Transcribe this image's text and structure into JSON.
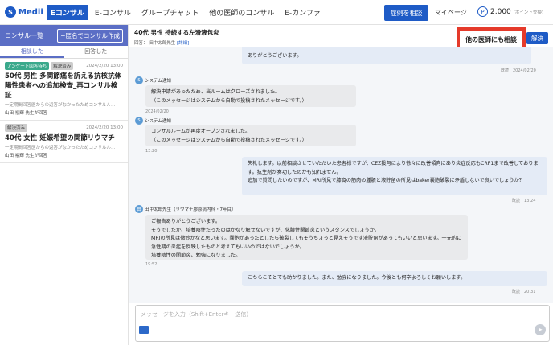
{
  "brand": {
    "name": "Medii",
    "product": "Eコンサル"
  },
  "nav": [
    "E-コンサル",
    "グループチャット",
    "他の医師のコンサル",
    "E-カンファ"
  ],
  "header": {
    "consult_button": "症例を相談",
    "mypage": "マイページ",
    "points": "2,000",
    "points_note": "(ポイント交換)"
  },
  "sidebar": {
    "title": "コンサル一覧",
    "new_button": "+匿名でコンサル作成",
    "tabs": [
      "相談した",
      "回答した"
    ],
    "cases": [
      {
        "badges": [
          "アンケート回答待ち",
          "解決済み"
        ],
        "time": "2024/2/20 13:00",
        "title": "50代 男性 多関節痛を訴える抗核抗体陽性患者への追加検査_再コンサル検証",
        "snippet": "一定期間回答医からの返答がなかったためコンサルル…",
        "doctor": "山田 裕輝 先生が回答"
      },
      {
        "badges": [
          "解決済み"
        ],
        "time": "2024/2/20 13:00",
        "title": "40代 女性 妊娠希望の関節リウマチ",
        "snippet": "一定期間回答医からの返答がなかったためコンサルル…",
        "doctor": "山田 裕輝 先生が回答"
      }
    ]
  },
  "chat": {
    "title": "40代 男性 持続する左滑液包炎",
    "responder_label": "回答：",
    "responder": "田中太郎先生",
    "detail_link": "[詳細]",
    "other_doctors_button": "他の医師にも相談",
    "resolve_button": "解決",
    "messages": [
      {
        "kind": "self",
        "text": "ありがとうございます。",
        "time": "既読　2024/02/20"
      },
      {
        "kind": "system",
        "sender": "システム通知",
        "text": "解決申請があったため、当ルームはクローズされました。\n（このメッセージはシステムから自動で投稿されたメッセージです。）",
        "time": "2024/02/20"
      },
      {
        "kind": "system",
        "sender": "システム通知",
        "text": "コンサルルームが再度オープンされました。\n（このメッセージはシステムから自動で投稿されたメッセージです。）",
        "time": "13:20"
      },
      {
        "kind": "self",
        "text": "失礼します。以前相談させていただいた患者様ですが、CEZ投与により徐々に改善傾向にあり炎症反応もCRP1まで改善しております。抗生剤が奏功したのかも知れません。\n追加で質問したいのですが、MRI所見で膝窩の筋肉の腫脹と液貯留の所見はbaker嚢胞破裂に矛盾しないで良いでしょうか？",
        "time": "既読　13:24"
      },
      {
        "kind": "doctor",
        "sender": "田中太郎先生（リウマチ膠原病内科・7年目）",
        "text": "ご報告ありがとうございます。\nそうでしたか、培養陰性だったのはかなり解せないですが、化膿性関節炎というスタンスでしょうか。\nMRIの所見は微妙かなと思います。嚢胞があったとしたら破裂してもそうちょっと見えそうです液貯留があってもいいと思います。一元的に急性期の炎症を反映したものと考えてもいいのではないでしょうか。\n培養陰性の関節炎、勉強になりました。",
        "time": "19:52"
      },
      {
        "kind": "self",
        "text": "こちらこそとても助かりました。また、勉強になりました。今後とも何卒よろしくお願いします。",
        "time": "既読　20:31"
      }
    ],
    "composer_placeholder": "メッセージを入力（Shift+Enterキー送信）"
  },
  "icons": {
    "avatar": "doctor-avatar-icon",
    "image": "image-icon",
    "send": "send-icon",
    "points": "points-icon"
  },
  "colors": {
    "brand": "#1e5bc6",
    "sidebar_header": "#5b6ec5",
    "highlight": "#e53a2a"
  }
}
